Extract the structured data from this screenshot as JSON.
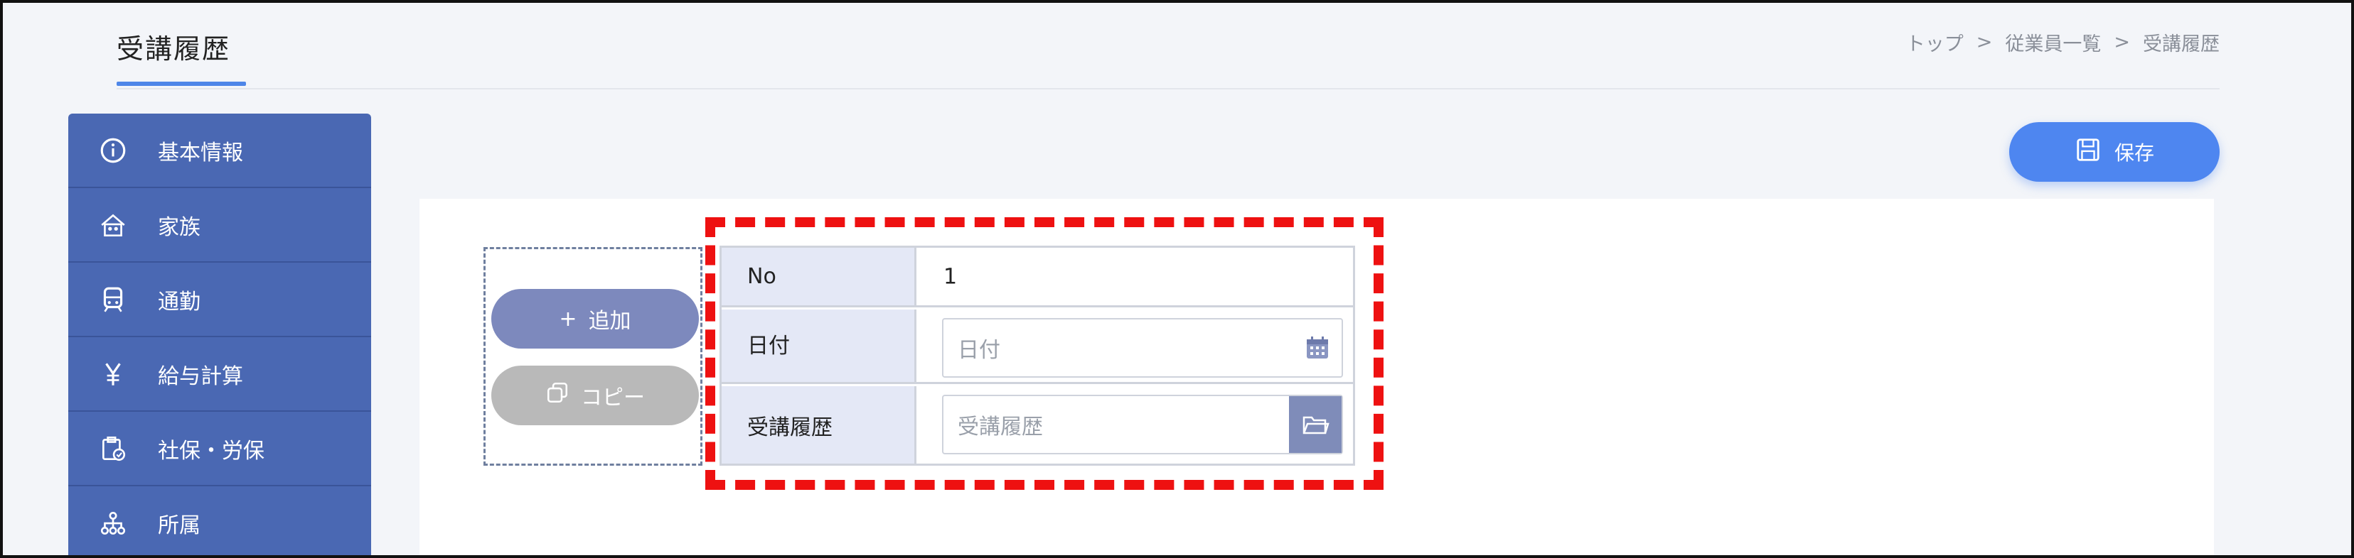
{
  "header": {
    "title": "受講履歴",
    "breadcrumb": [
      "トップ",
      "従業員一覧",
      "受講履歴"
    ],
    "breadcrumb_sep": ">"
  },
  "sidebar": {
    "items": [
      {
        "label": "基本情報",
        "icon": "info-icon"
      },
      {
        "label": "家族",
        "icon": "house-icon"
      },
      {
        "label": "通勤",
        "icon": "train-icon"
      },
      {
        "label": "給与計算",
        "icon": "yen-icon"
      },
      {
        "label": "社保・労保",
        "icon": "insurance-icon"
      },
      {
        "label": "所属",
        "icon": "org-chart-icon"
      }
    ]
  },
  "toolbar": {
    "save_label": "保存",
    "add_label": "追加",
    "add_symbol": "+",
    "copy_label": "コピー"
  },
  "form": {
    "no_label": "No",
    "no_value": "1",
    "date_label": "日付",
    "date_placeholder": "日付",
    "course_label": "受講履歴",
    "course_placeholder": "受講履歴"
  },
  "colors": {
    "sidebar": "#4a68b3",
    "accent": "#4e86f0",
    "add_button": "#7d89bd",
    "copy_button": "#b9b9b9",
    "highlight": "#ee1111",
    "label_bg": "#e4e8f6"
  }
}
